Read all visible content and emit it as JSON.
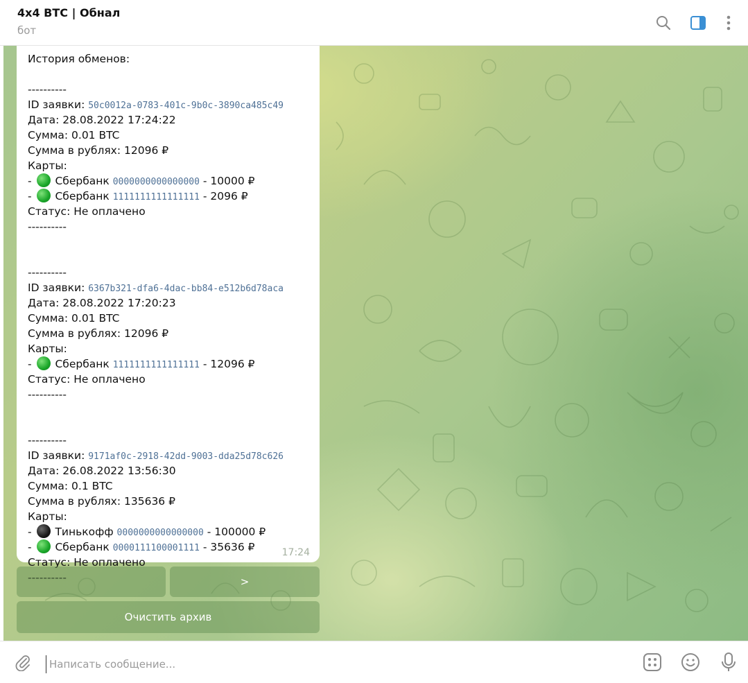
{
  "header": {
    "title": "4x4 BTC | Обнал",
    "subtitle": "бот",
    "icons": [
      "search-icon",
      "sidebar-toggle-icon",
      "more-vertical-icon"
    ]
  },
  "message": {
    "heading": "История обменов:",
    "separator": "----------",
    "labels": {
      "id": "ID заявки: ",
      "date": "Дата: ",
      "sum": "Сумма: ",
      "rub": "Сумма в рублях: ",
      "cards": "Карты:",
      "status": "Статус: "
    },
    "orders": [
      {
        "id": "50c0012a-0783-401c-9b0c-3890ca485c49",
        "date": "28.08.2022 17:24:22",
        "sum": "0.01 BTC",
        "rub": "12096 ₽",
        "cards": [
          {
            "bank": "Сбербанк",
            "number": "0000000000000000",
            "amount": "10000 ₽",
            "dot": "green"
          },
          {
            "bank": "Сбербанк",
            "number": "1111111111111111",
            "amount": "2096 ₽",
            "dot": "green"
          }
        ],
        "status": "Не оплачено"
      },
      {
        "id": "6367b321-dfa6-4dac-bb84-e512b6d78aca",
        "date": "28.08.2022 17:20:23",
        "sum": "0.01 BTC",
        "rub": "12096 ₽",
        "cards": [
          {
            "bank": "Сбербанк",
            "number": "1111111111111111",
            "amount": "12096 ₽",
            "dot": "green"
          }
        ],
        "status": "Не оплачено"
      },
      {
        "id": "9171af0c-2918-42dd-9003-dda25d78c626",
        "date": "26.08.2022 13:56:30",
        "sum": "0.1 BTC",
        "rub": "135636 ₽",
        "cards": [
          {
            "bank": "Тинькофф",
            "number": "0000000000000000",
            "amount": "100000 ₽",
            "dot": "black"
          },
          {
            "bank": "Сбербанк",
            "number": "0000111100001111",
            "amount": "35636 ₽",
            "dot": "green"
          }
        ],
        "status": "Не оплачено"
      }
    ],
    "time": "17:24"
  },
  "keyboard": {
    "prev_label": "",
    "next_label": ">",
    "clear_label": "Очистить архив"
  },
  "composer": {
    "placeholder": "Написать сообщение...",
    "icons": [
      "attach-icon",
      "bot-commands-icon",
      "emoji-icon",
      "microphone-icon"
    ]
  },
  "colors": {
    "link_mono": "#4f7196",
    "dot_green": "#1aa629",
    "dot_black": "#111111",
    "header_icon": "#8a8a8a",
    "accent_blue": "#3a8fd4"
  }
}
